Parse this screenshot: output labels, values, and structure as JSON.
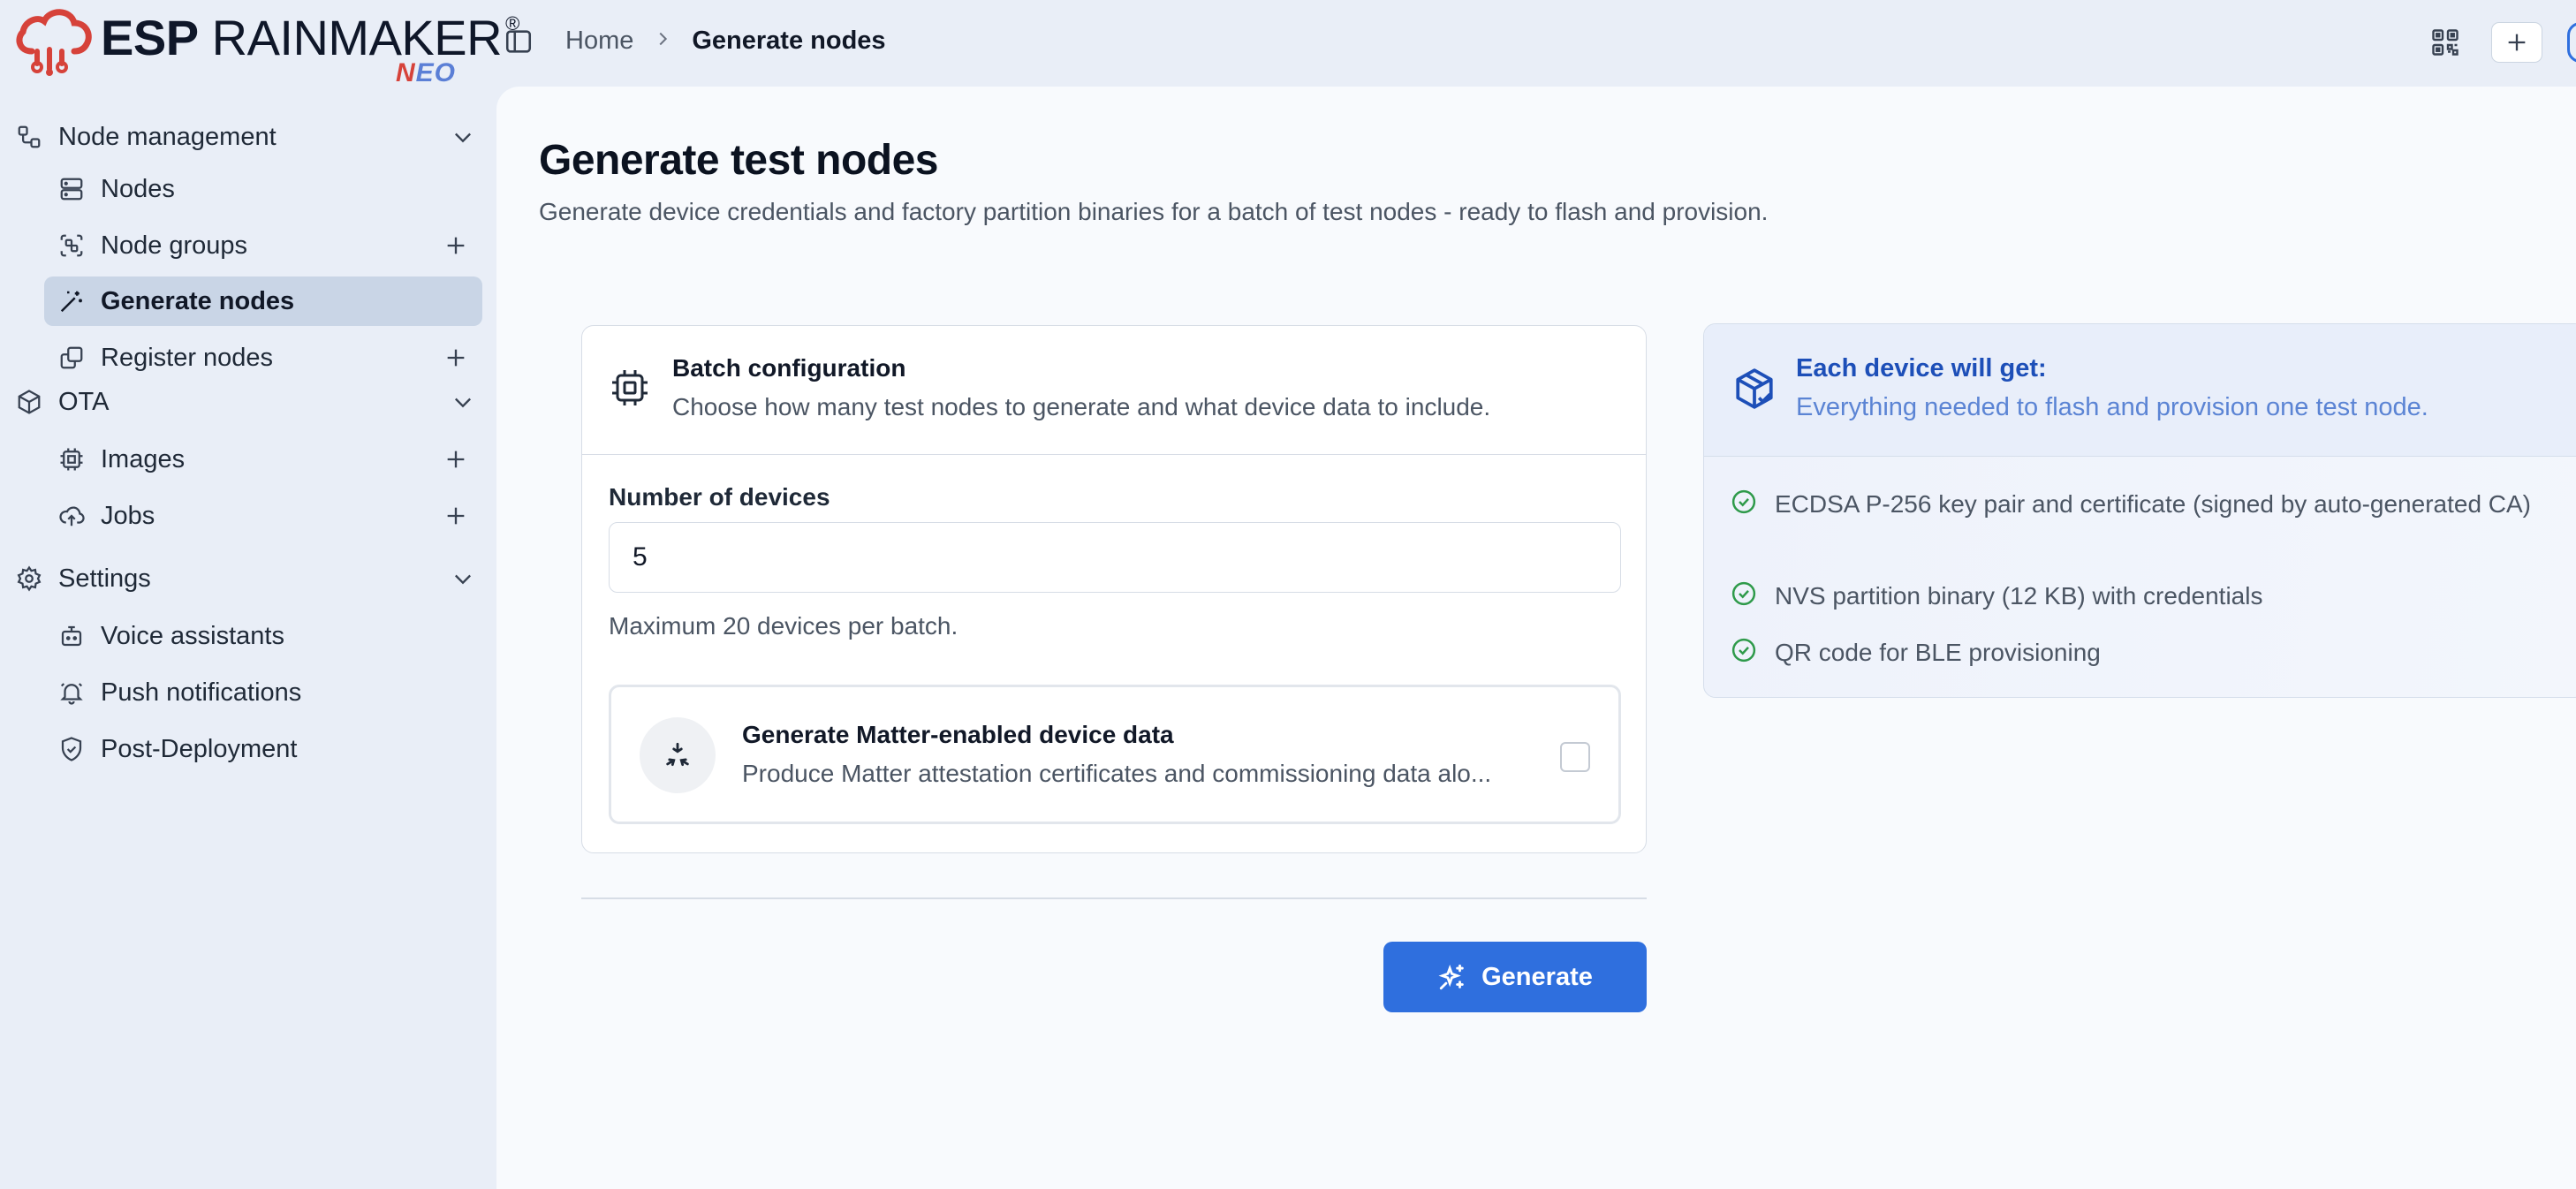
{
  "header": {
    "logo_main_bold": "ESP",
    "logo_main_rest": " RAINMAKER",
    "logo_reg": "®",
    "logo_sub_first": "N",
    "logo_sub_rest": "EO",
    "breadcrumb": {
      "home": "Home",
      "current": "Generate nodes"
    }
  },
  "sidebar": {
    "sections": [
      {
        "label": "Node management",
        "icon": "node-management-icon"
      },
      {
        "label": "OTA",
        "icon": "package-icon"
      },
      {
        "label": "Settings",
        "icon": "gear-icon"
      }
    ],
    "items": [
      {
        "label": "Nodes",
        "icon": "server-icon",
        "has_add": false,
        "active": false
      },
      {
        "label": "Node groups",
        "icon": "group-icon",
        "has_add": true,
        "active": false
      },
      {
        "label": "Generate nodes",
        "icon": "magic-wand-icon",
        "has_add": false,
        "active": true
      },
      {
        "label": "Register nodes",
        "icon": "register-icon",
        "has_add": true,
        "active": false
      },
      {
        "label": "Images",
        "icon": "chip-icon",
        "has_add": true,
        "active": false
      },
      {
        "label": "Jobs",
        "icon": "cloud-upload-icon",
        "has_add": true,
        "active": false
      },
      {
        "label": "Voice assistants",
        "icon": "bot-icon",
        "has_add": false,
        "active": false
      },
      {
        "label": "Push notifications",
        "icon": "bell-icon",
        "has_add": false,
        "active": false
      },
      {
        "label": "Post-Deployment",
        "icon": "shield-check-icon",
        "has_add": false,
        "active": false
      }
    ]
  },
  "main": {
    "title": "Generate test nodes",
    "subtitle": "Generate device credentials and factory partition binaries for a batch of test nodes - ready to flash and provision.",
    "config": {
      "title": "Batch configuration",
      "description": "Choose how many test nodes to generate and what device data to include.",
      "num_label": "Number of devices",
      "num_value": "5",
      "num_hint": "Maximum 20 devices per batch.",
      "matter_title": "Generate Matter-enabled device data",
      "matter_desc": "Produce Matter attestation certificates and commissioning data alo...",
      "matter_checked": false
    },
    "generate_label": "Generate",
    "info": {
      "title": "Each device will get:",
      "description": "Everything needed to flash and provision one test node.",
      "items": [
        "ECDSA P-256 key pair and certificate (signed by auto-generated CA)",
        "NVS partition binary (12 KB) with credentials",
        "QR code for BLE provisioning"
      ]
    }
  },
  "colors": {
    "accent": "#2f6fde",
    "active_nav": "#c9d5e6",
    "info_title": "#1d4fb8",
    "success": "#2e9a4a",
    "logo_red": "#d6423a"
  }
}
